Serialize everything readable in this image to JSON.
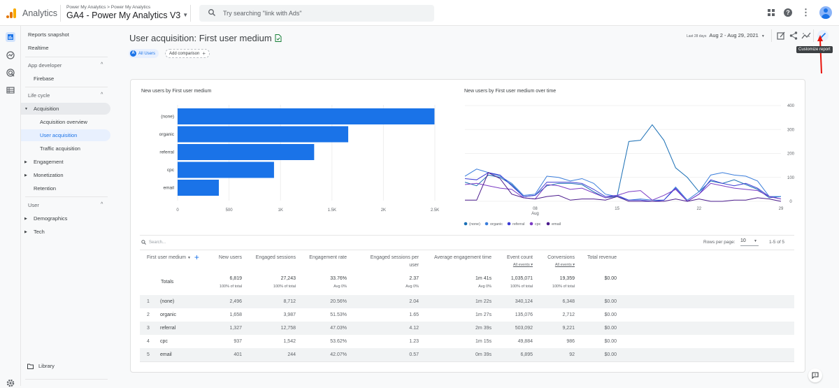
{
  "topbar": {
    "app_name": "Analytics",
    "breadcrumb": "Power My Analytics > Power My Analytics",
    "property": "GA4 - Power My Analytics V3",
    "search_placeholder": "Try searching \"link with Ads\"",
    "icons": [
      "apps-icon",
      "help-icon",
      "more-vert-icon",
      "account-avatar"
    ]
  },
  "rail": {
    "items": [
      "reports-icon",
      "explore-icon",
      "advertising-icon",
      "configure-icon"
    ],
    "bottom": "settings-icon"
  },
  "sidebar": {
    "items": [
      {
        "label": "Reports snapshot",
        "type": "item"
      },
      {
        "label": "Realtime",
        "type": "item"
      },
      {
        "label": "App developer",
        "type": "section"
      },
      {
        "label": "Firebase",
        "type": "item"
      },
      {
        "label": "Life cycle",
        "type": "section"
      },
      {
        "label": "Acquisition",
        "type": "group",
        "expanded": true
      },
      {
        "label": "Acquisition overview",
        "type": "sub"
      },
      {
        "label": "User acquisition",
        "type": "sub",
        "selected": true
      },
      {
        "label": "Traffic acquisition",
        "type": "sub"
      },
      {
        "label": "Engagement",
        "type": "group"
      },
      {
        "label": "Monetization",
        "type": "group"
      },
      {
        "label": "Retention",
        "type": "item"
      },
      {
        "label": "User",
        "type": "section"
      },
      {
        "label": "Demographics",
        "type": "group"
      },
      {
        "label": "Tech",
        "type": "group"
      }
    ],
    "library": "Library"
  },
  "header": {
    "title": "User acquisition: First user medium",
    "segment_chip": "All Users",
    "segment_letter": "A",
    "add_comparison": "Add comparison",
    "date_label": "Last 28 days",
    "date_range": "Aug 2 - Aug 29, 2021",
    "tooltip": "Customize report"
  },
  "colors": {
    "accent": "#1a73e8",
    "series": [
      "#1a6fb5",
      "#3a7ddb",
      "#3b3bd4",
      "#7b3bc4",
      "#4a1a8c"
    ]
  },
  "chart_data": [
    {
      "type": "bar",
      "title": "New users by First user medium",
      "categories": [
        "(none)",
        "organic",
        "referral",
        "cpc",
        "email"
      ],
      "values": [
        2496,
        1658,
        1327,
        937,
        401
      ],
      "xlim": [
        0,
        2500
      ],
      "xticks": [
        "0",
        "500",
        "1K",
        "1.5K",
        "2K",
        "2.5K"
      ],
      "xtick_values": [
        0,
        500,
        1000,
        1500,
        2000,
        2500
      ],
      "color": "#1a73e8",
      "grid": true
    },
    {
      "type": "line",
      "title": "New users by First user medium over time",
      "x": [
        "Aug 2",
        "Aug 3",
        "Aug 4",
        "Aug 5",
        "Aug 6",
        "Aug 7",
        "Aug 8",
        "Aug 9",
        "Aug 10",
        "Aug 11",
        "Aug 12",
        "Aug 13",
        "Aug 14",
        "Aug 15",
        "Aug 16",
        "Aug 17",
        "Aug 18",
        "Aug 19",
        "Aug 20",
        "Aug 21",
        "Aug 22",
        "Aug 23",
        "Aug 24",
        "Aug 25",
        "Aug 26",
        "Aug 27",
        "Aug 28",
        "Aug 29"
      ],
      "xtick_labels": [
        {
          "i": 6,
          "label": "08",
          "sub": "Aug"
        },
        {
          "i": 13,
          "label": "15"
        },
        {
          "i": 20,
          "label": "22"
        },
        {
          "i": 27,
          "label": "29"
        }
      ],
      "ylim": [
        0,
        400
      ],
      "yticks": [
        0,
        100,
        200,
        300,
        400
      ],
      "y_axis_side": "right",
      "legend_position": "bottom-left",
      "series": [
        {
          "name": "(none)",
          "values": [
            80,
            65,
            110,
            100,
            70,
            20,
            25,
            65,
            75,
            75,
            70,
            40,
            15,
            20,
            250,
            255,
            320,
            255,
            140,
            100,
            40,
            85,
            75,
            90,
            70,
            50,
            15,
            20
          ]
        },
        {
          "name": "organic",
          "values": [
            105,
            135,
            120,
            105,
            75,
            25,
            30,
            105,
            100,
            85,
            95,
            75,
            30,
            20,
            5,
            10,
            5,
            5,
            60,
            5,
            40,
            110,
            120,
            110,
            105,
            85,
            20,
            20
          ]
        },
        {
          "name": "referral",
          "values": [
            95,
            90,
            120,
            110,
            65,
            20,
            25,
            80,
            80,
            80,
            75,
            50,
            20,
            25,
            5,
            5,
            0,
            5,
            55,
            0,
            30,
            90,
            75,
            65,
            75,
            55,
            20,
            10
          ]
        },
        {
          "name": "cpc",
          "values": [
            70,
            75,
            65,
            55,
            50,
            15,
            10,
            70,
            65,
            50,
            55,
            35,
            15,
            25,
            40,
            45,
            5,
            25,
            50,
            0,
            30,
            75,
            65,
            55,
            50,
            45,
            20,
            10
          ]
        },
        {
          "name": "email",
          "values": [
            5,
            5,
            120,
            95,
            30,
            15,
            10,
            20,
            25,
            5,
            10,
            10,
            5,
            20,
            0,
            0,
            0,
            0,
            10,
            0,
            10,
            0,
            0,
            5,
            5,
            15,
            10,
            0
          ]
        }
      ]
    }
  ],
  "table": {
    "search_placeholder": "Search...",
    "rows_per_page_label": "Rows per page:",
    "rows_per_page": "10",
    "pagination": "1-5 of 5",
    "columns": [
      {
        "label": "First user medium",
        "sub": ""
      },
      {
        "label": "New users",
        "sub": ""
      },
      {
        "label": "Engaged sessions",
        "sub": ""
      },
      {
        "label": "Engagement rate",
        "sub": ""
      },
      {
        "label": "Engaged sessions per user",
        "sub": ""
      },
      {
        "label": "Average engagement time",
        "sub": ""
      },
      {
        "label": "Event count",
        "sub": "All events"
      },
      {
        "label": "Conversions",
        "sub": "All events"
      },
      {
        "label": "Total revenue",
        "sub": ""
      }
    ],
    "totals": {
      "label": "Totals",
      "values": [
        "6,819",
        "27,243",
        "33.76%",
        "2.37",
        "1m 41s",
        "1,035,071",
        "19,359",
        "$0.00"
      ],
      "subs": [
        "100% of total",
        "100% of total",
        "Avg 0%",
        "Avg 0%",
        "Avg 0%",
        "100% of total",
        "100% of total",
        ""
      ]
    },
    "rows": [
      {
        "n": "1",
        "medium": "(none)",
        "values": [
          "2,496",
          "8,712",
          "20.56%",
          "2.04",
          "1m 22s",
          "340,124",
          "6,348",
          "$0.00"
        ]
      },
      {
        "n": "2",
        "medium": "organic",
        "values": [
          "1,658",
          "3,987",
          "51.53%",
          "1.65",
          "1m 27s",
          "135,076",
          "2,712",
          "$0.00"
        ]
      },
      {
        "n": "3",
        "medium": "referral",
        "values": [
          "1,327",
          "12,758",
          "47.03%",
          "4.12",
          "2m 39s",
          "503,092",
          "9,221",
          "$0.00"
        ]
      },
      {
        "n": "4",
        "medium": "cpc",
        "values": [
          "937",
          "1,542",
          "53.62%",
          "1.23",
          "1m 15s",
          "49,884",
          "986",
          "$0.00"
        ]
      },
      {
        "n": "5",
        "medium": "email",
        "values": [
          "401",
          "244",
          "42.07%",
          "0.57",
          "0m 39s",
          "6,895",
          "92",
          "$0.00"
        ]
      }
    ]
  }
}
